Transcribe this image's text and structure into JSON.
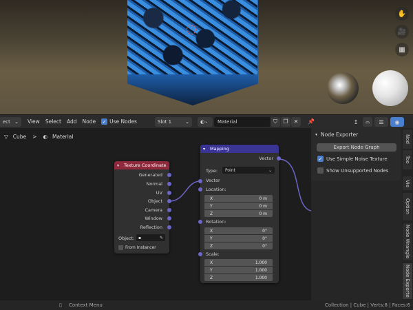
{
  "viewport": {
    "nav_icons": [
      "hand-icon",
      "camera-icon",
      "grid-icon"
    ]
  },
  "header": {
    "editor_dropdown": "ect",
    "menus": [
      "View",
      "Select",
      "Add",
      "Node"
    ],
    "use_nodes_label": "Use Nodes",
    "slot": "Slot 1",
    "material_name": "Material"
  },
  "breadcrumb": {
    "object": "Cube",
    "separator": ">",
    "material": "Material"
  },
  "texture_coordinate": {
    "title": "Texture Coordinate",
    "outputs": [
      "Generated",
      "Normal",
      "UV",
      "Object",
      "Camera",
      "Window",
      "Reflection"
    ],
    "object_label": "Object:",
    "from_instancer": "From Instancer"
  },
  "mapping": {
    "title": "Mapping",
    "output": "Vector",
    "type_label": "Type:",
    "type_value": "Point",
    "vector_input": "Vector",
    "location": {
      "label": "Location:",
      "x": "0 m",
      "y": "0 m",
      "z": "0 m"
    },
    "rotation": {
      "label": "Rotation:",
      "x": "0°",
      "y": "0°",
      "z": "0°"
    },
    "scale": {
      "label": "Scale:",
      "x": "1.000",
      "y": "1.000",
      "z": "1.000"
    },
    "axis": {
      "x": "X",
      "y": "Y",
      "z": "Z"
    }
  },
  "node_exporter": {
    "title": "Node Exporter",
    "export_button": "Export Node Graph",
    "simple_noise": "Use Simple Noise Texture",
    "show_unsupported": "Show Unsupported Nodes"
  },
  "side_tabs": [
    "Nod",
    "Too",
    "Vie",
    "Option",
    "Node Wrangle",
    "Node Exporte"
  ],
  "status_bar": {
    "context_menu": "Context Menu",
    "stats": "Collection | Cube | Verts:8 | Faces:6"
  },
  "colors": {
    "texture_coordinate_header": "#8e2a3c",
    "mapping_header": "#3a3594",
    "socket_vector": "#6c66c8",
    "accent": "#4a7fcf"
  }
}
